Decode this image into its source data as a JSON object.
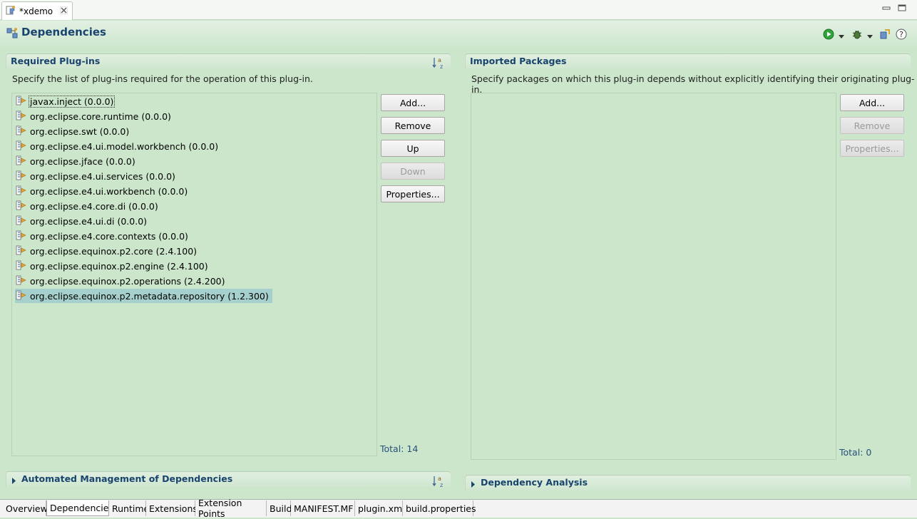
{
  "editor": {
    "tab_title": "*xdemo",
    "tab_icon": "plugin-manifest-icon",
    "close_icon": "close-icon"
  },
  "window_controls": [
    "minimize-icon",
    "maximize-icon"
  ],
  "header": {
    "title": "Dependencies",
    "icon": "dependencies-icon",
    "toolbar_icons": [
      "run-icon",
      "dropdown-arrow-icon",
      "debug-icon",
      "dropdown-arrow-icon",
      "export-icon",
      "help-icon"
    ]
  },
  "required_plugins": {
    "title": "Required Plug-ins",
    "description": "Specify the list of plug-ins required for the operation of this plug-in.",
    "sort_icon": "sort-alphabetically-icon",
    "items": [
      "javax.inject (0.0.0)",
      "org.eclipse.core.runtime (0.0.0)",
      "org.eclipse.swt (0.0.0)",
      "org.eclipse.e4.ui.model.workbench (0.0.0)",
      "org.eclipse.jface (0.0.0)",
      "org.eclipse.e4.ui.services (0.0.0)",
      "org.eclipse.e4.ui.workbench (0.0.0)",
      "org.eclipse.e4.core.di (0.0.0)",
      "org.eclipse.e4.ui.di (0.0.0)",
      "org.eclipse.e4.core.contexts (0.0.0)",
      "org.eclipse.equinox.p2.core (2.4.100)",
      "org.eclipse.equinox.p2.engine (2.4.100)",
      "org.eclipse.equinox.p2.operations (2.4.200)",
      "org.eclipse.equinox.p2.metadata.repository (1.2.300)"
    ],
    "selected_item": "org.eclipse.equinox.p2.metadata.repository (1.2.300)",
    "focused_item": "javax.inject (0.0.0)",
    "item_icon": "plugin-icon",
    "buttons": {
      "add": "Add...",
      "remove": "Remove",
      "up": "Up",
      "down": "Down",
      "properties": "Properties..."
    },
    "total": "Total: 14"
  },
  "imported_packages": {
    "title": "Imported Packages",
    "description": "Specify packages on which this plug-in depends without explicitly identifying their originating plug-in.",
    "buttons": {
      "add": "Add...",
      "remove": "Remove",
      "properties": "Properties..."
    },
    "total": "Total: 0"
  },
  "automated_management": {
    "title": "Automated Management of Dependencies",
    "expand_icon": "collapsed-triangle-icon",
    "sort_icon": "sort-alphabetically-icon"
  },
  "dependency_analysis": {
    "title": "Dependency Analysis",
    "expand_icon": "collapsed-triangle-icon"
  },
  "page_tabs": [
    "Overview",
    "Dependencies",
    "Runtime",
    "Extensions",
    "Extension Points",
    "Build",
    "MANIFEST.MF",
    "plugin.xml",
    "build.properties"
  ],
  "active_page_tab": "Dependencies",
  "colors": {
    "background": "#cbe6cb",
    "title_text": "#19446e",
    "selection": "#a6d0cd",
    "total_text": "#28507a"
  }
}
